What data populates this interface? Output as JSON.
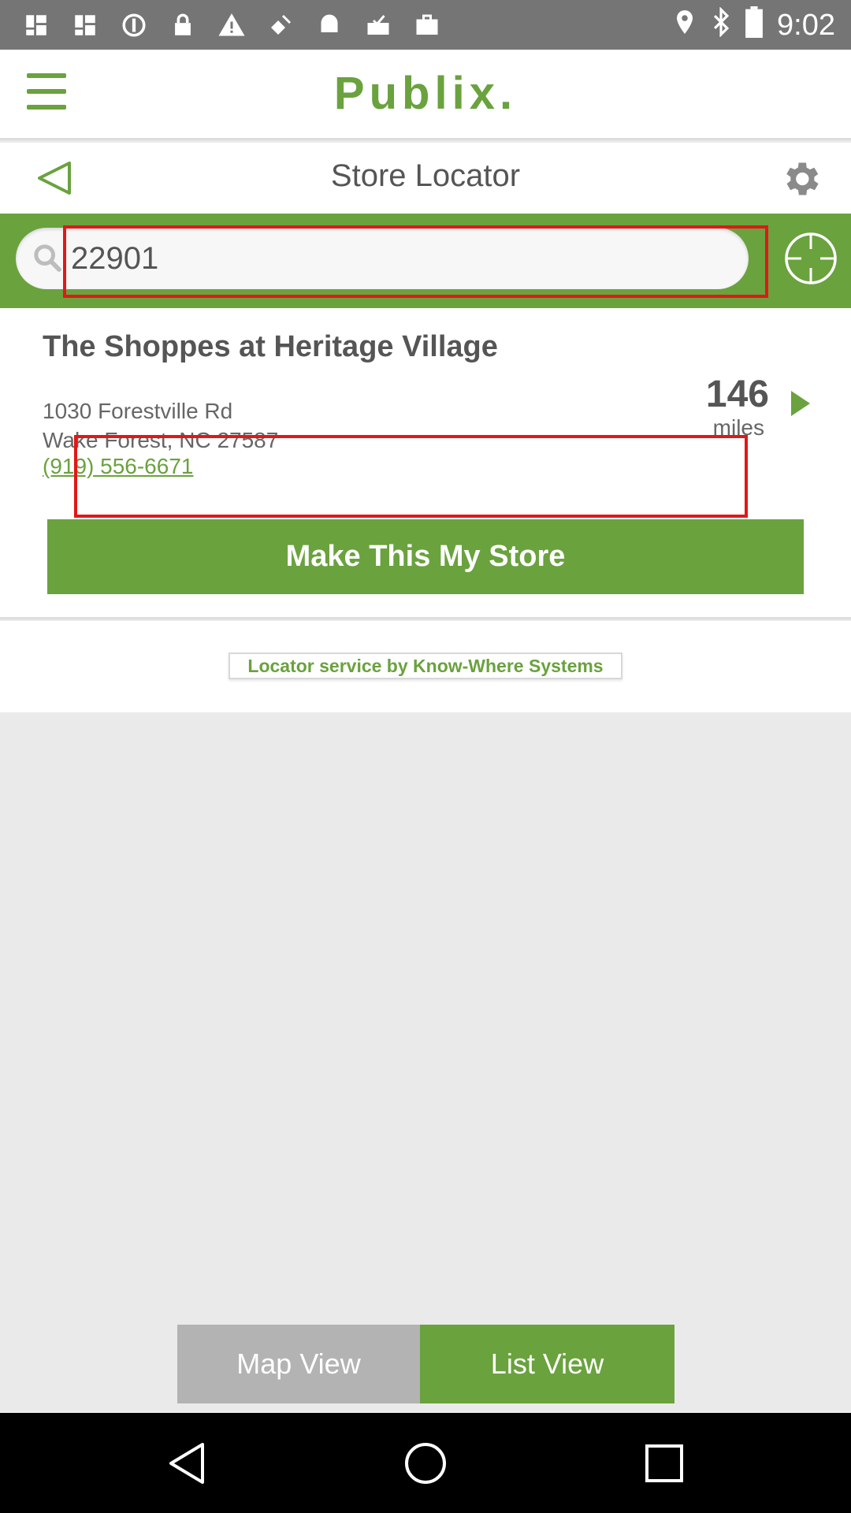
{
  "status_bar": {
    "time": "9:02",
    "icons": [
      "photos-icon",
      "photos-icon",
      "sync-icon",
      "lock-icon",
      "warning-icon",
      "fake-gps-icon",
      "android-icon",
      "inbox-icon",
      "briefcase-icon"
    ],
    "right_icons": [
      "location-icon",
      "bluetooth-icon",
      "battery-icon"
    ]
  },
  "header": {
    "logo": "Publix."
  },
  "subheader": {
    "title": "Store Locator"
  },
  "search": {
    "value": "22901"
  },
  "store": {
    "name": "The Shoppes at Heritage Village",
    "address_line1": "1030 Forestville Rd",
    "address_line2": "Wake Forest, NC 27587",
    "phone": "(919) 556-6671",
    "distance": "146",
    "distance_unit": "miles",
    "make_store_label": "Make This My Store"
  },
  "attribution": {
    "text": "Locator service by Know-Where Systems"
  },
  "view_toggle": {
    "map_label": "Map View",
    "list_label": "List View",
    "active": "List View"
  },
  "colors": {
    "brand_green": "#6aa23e",
    "highlight_red": "#e01818",
    "inactive_gray": "#b3b3b3"
  }
}
